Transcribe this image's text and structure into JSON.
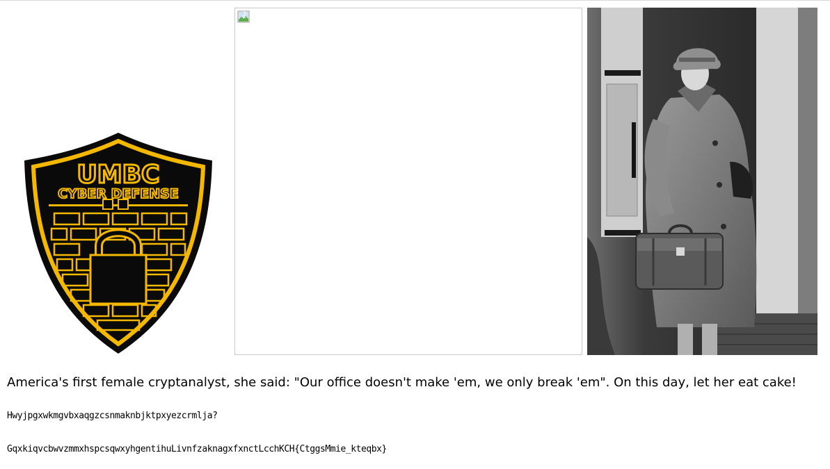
{
  "logo": {
    "line1": "UMBC",
    "line2": "CYBER DEFENSE"
  },
  "caption": {
    "quote": "America's first female cryptanalyst, she said: \"Our office doesn't make 'em, we only break 'em\". On this day, let her eat cake!"
  },
  "cipher": {
    "line1": "Hwyjpgxwkmgvbxaqgzcsnmaknbjktpxyezcrmlja?",
    "line2": "GqxkiqvcbwvzmmxhspcsqwxyhgentihuLivnfzaknagxfxnctLcchKCH{CtggsMmie_kteqbx}"
  },
  "colors": {
    "shield_yellow": "#f5b800",
    "shield_black": "#0a0a0a"
  }
}
